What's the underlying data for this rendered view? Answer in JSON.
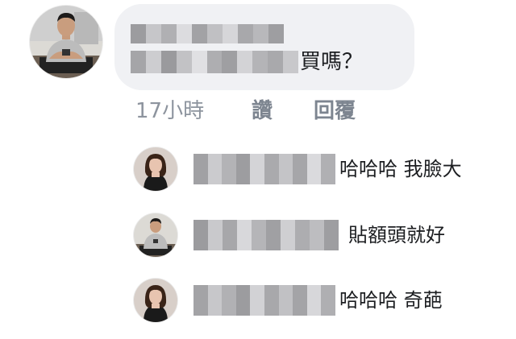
{
  "main_comment": {
    "visible_text": "買嗎？",
    "time": "17小時",
    "like_label": "讚",
    "reply_label": "回覆"
  },
  "replies": [
    {
      "text": "哈哈哈 我臉大",
      "avatar": "woman-avatar"
    },
    {
      "text": "貼額頭就好",
      "avatar": "man-avatar"
    },
    {
      "text": "哈哈哈 奇葩",
      "avatar": "woman-avatar"
    }
  ],
  "colors": {
    "bubble_bg": "#f0f1f4",
    "meta_text": "#8d949e",
    "body_text": "#1c1e21"
  }
}
